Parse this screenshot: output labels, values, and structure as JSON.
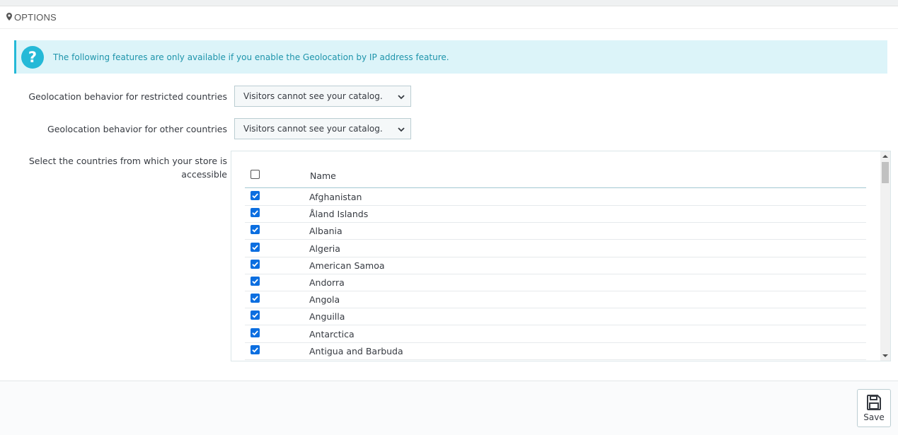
{
  "panel": {
    "heading": "OPTIONS",
    "heading_icon": "map-marker-icon"
  },
  "alert": {
    "icon": "question-icon",
    "text": "The following features are only available if you enable the Geolocation by IP address feature."
  },
  "form": {
    "restricted_label": "Geolocation behavior for restricted countries",
    "restricted_value": "Visitors cannot see your catalog.",
    "other_label": "Geolocation behavior for other countries",
    "other_value": "Visitors cannot see your catalog.",
    "countries_label_line1": "Select the countries from which your store is",
    "countries_label_line2": "accessible"
  },
  "countries_table": {
    "header_name": "Name",
    "select_all_checked": false,
    "rows": [
      {
        "name": "Afghanistan",
        "checked": true
      },
      {
        "name": "Åland Islands",
        "checked": true
      },
      {
        "name": "Albania",
        "checked": true
      },
      {
        "name": "Algeria",
        "checked": true
      },
      {
        "name": "American Samoa",
        "checked": true
      },
      {
        "name": "Andorra",
        "checked": true
      },
      {
        "name": "Angola",
        "checked": true
      },
      {
        "name": "Anguilla",
        "checked": true
      },
      {
        "name": "Antarctica",
        "checked": true
      },
      {
        "name": "Antigua and Barbuda",
        "checked": true
      }
    ]
  },
  "footer": {
    "save_label": "Save",
    "save_icon": "floppy-disk-icon"
  },
  "colors": {
    "accent": "#25b9d7",
    "alert_bg": "#dcf4f9",
    "alert_text": "#1e94ab",
    "checkbox": "#0b6ee0"
  }
}
